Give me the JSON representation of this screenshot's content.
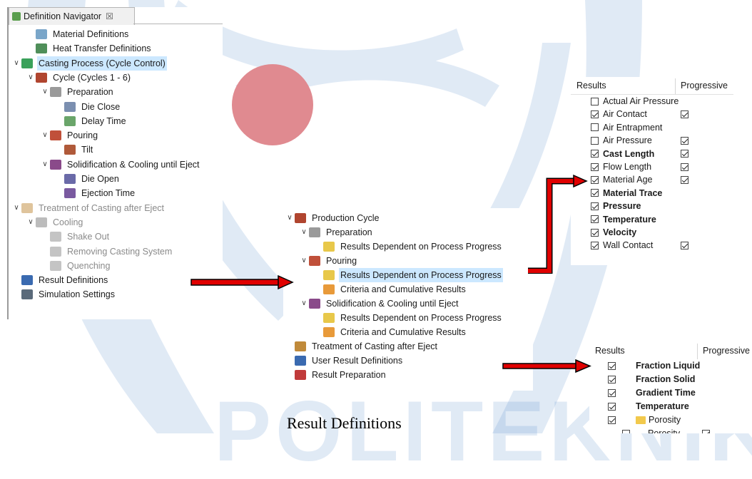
{
  "navigator": {
    "tab_title": "Definition Navigator",
    "tab_close": "☒",
    "items": [
      {
        "label": "Material Definitions",
        "level": 1,
        "icon": "material-icon",
        "twisty": "",
        "state": "normal"
      },
      {
        "label": "Heat Transfer Definitions",
        "level": 1,
        "icon": "heat-transfer-icon",
        "twisty": "",
        "state": "normal"
      },
      {
        "label": "Casting Process (Cycle Control)",
        "level": 0,
        "icon": "cycle-control-icon",
        "twisty": "v",
        "state": "selected"
      },
      {
        "label": "Cycle (Cycles 1 - 6)",
        "level": 1,
        "icon": "cycle-icon",
        "twisty": "v",
        "state": "normal"
      },
      {
        "label": "Preparation",
        "level": 2,
        "icon": "preparation-icon",
        "twisty": "v",
        "state": "normal"
      },
      {
        "label": "Die Close",
        "level": 3,
        "icon": "die-close-icon",
        "twisty": "",
        "state": "normal"
      },
      {
        "label": "Delay Time",
        "level": 3,
        "icon": "delay-time-icon",
        "twisty": "",
        "state": "normal"
      },
      {
        "label": "Pouring",
        "level": 2,
        "icon": "pouring-icon",
        "twisty": "v",
        "state": "normal"
      },
      {
        "label": "Tilt",
        "level": 3,
        "icon": "tilt-icon",
        "twisty": "",
        "state": "normal"
      },
      {
        "label": "Solidification & Cooling until Eject",
        "level": 2,
        "icon": "solidification-icon",
        "twisty": "v",
        "state": "normal"
      },
      {
        "label": "Die Open",
        "level": 3,
        "icon": "die-open-icon",
        "twisty": "",
        "state": "normal"
      },
      {
        "label": "Ejection Time",
        "level": 3,
        "icon": "ejection-icon",
        "twisty": "",
        "state": "normal"
      },
      {
        "label": "Treatment of Casting after Eject",
        "level": 0,
        "icon": "treatment-icon",
        "twisty": "v",
        "state": "dim"
      },
      {
        "label": "Cooling",
        "level": 1,
        "icon": "cooling-icon",
        "twisty": "v",
        "state": "dim"
      },
      {
        "label": "Shake Out",
        "level": 2,
        "icon": "shake-out-icon",
        "twisty": "",
        "state": "dim"
      },
      {
        "label": "Removing Casting System",
        "level": 2,
        "icon": "removing-icon",
        "twisty": "",
        "state": "dim"
      },
      {
        "label": "Quenching",
        "level": 2,
        "icon": "quenching-icon",
        "twisty": "",
        "state": "dim"
      },
      {
        "label": "Result Definitions",
        "level": 0,
        "icon": "result-definitions-icon",
        "twisty": "",
        "state": "normal"
      },
      {
        "label": "Simulation Settings",
        "level": 0,
        "icon": "simulation-settings-icon",
        "twisty": "",
        "state": "normal"
      }
    ]
  },
  "production_tree": {
    "items": [
      {
        "label": "Production Cycle",
        "level": 0,
        "icon": "production-cycle-icon",
        "twisty": "v",
        "state": "normal"
      },
      {
        "label": "Preparation",
        "level": 1,
        "icon": "preparation-icon",
        "twisty": "v",
        "state": "normal"
      },
      {
        "label": "Results Dependent on Process Progress",
        "level": 2,
        "icon": "results-progress-icon",
        "twisty": "",
        "state": "normal"
      },
      {
        "label": "Pouring",
        "level": 1,
        "icon": "pouring-icon",
        "twisty": "v",
        "state": "normal"
      },
      {
        "label": "Results Dependent on Process Progress",
        "level": 2,
        "icon": "results-progress-icon",
        "twisty": "",
        "state": "selected"
      },
      {
        "label": "Criteria and Cumulative Results",
        "level": 2,
        "icon": "criteria-icon",
        "twisty": "",
        "state": "normal"
      },
      {
        "label": "Solidification & Cooling until Eject",
        "level": 1,
        "icon": "solidification-icon",
        "twisty": "v",
        "state": "normal"
      },
      {
        "label": "Results Dependent on Process Progress",
        "level": 2,
        "icon": "results-progress-icon",
        "twisty": "",
        "state": "normal"
      },
      {
        "label": "Criteria and Cumulative Results",
        "level": 2,
        "icon": "criteria-icon",
        "twisty": "",
        "state": "normal"
      },
      {
        "label": "Treatment of Casting after Eject",
        "level": 0,
        "icon": "treatment-icon",
        "twisty": "",
        "state": "normal"
      },
      {
        "label": "User Result Definitions",
        "level": 0,
        "icon": "user-results-icon",
        "twisty": "",
        "state": "normal"
      },
      {
        "label": "Result Preparation",
        "level": 0,
        "icon": "result-preparation-icon",
        "twisty": "",
        "state": "normal"
      }
    ]
  },
  "results_table_1": {
    "header_results": "Results",
    "header_progressive": "Progressive",
    "rows": [
      {
        "label": "Actual Air Pressure",
        "checked": false,
        "progressive": null,
        "bold": false
      },
      {
        "label": "Air Contact",
        "checked": true,
        "progressive": true,
        "bold": false
      },
      {
        "label": "Air Entrapment",
        "checked": false,
        "progressive": null,
        "bold": false
      },
      {
        "label": "Air Pressure",
        "checked": false,
        "progressive": true,
        "bold": false
      },
      {
        "label": "Cast Length",
        "checked": true,
        "progressive": true,
        "bold": true
      },
      {
        "label": "Flow Length",
        "checked": true,
        "progressive": true,
        "bold": false
      },
      {
        "label": "Material Age",
        "checked": true,
        "progressive": true,
        "bold": false
      },
      {
        "label": "Material Trace",
        "checked": true,
        "progressive": null,
        "bold": true
      },
      {
        "label": "Pressure",
        "checked": true,
        "progressive": null,
        "bold": true
      },
      {
        "label": "Temperature",
        "checked": true,
        "progressive": null,
        "bold": true
      },
      {
        "label": "Velocity",
        "checked": true,
        "progressive": null,
        "bold": true
      },
      {
        "label": "Wall Contact",
        "checked": true,
        "progressive": true,
        "bold": false
      }
    ]
  },
  "results_table_2": {
    "header_results": "Results",
    "header_progressive": "Progressive",
    "rows": [
      {
        "label": "Fraction Liquid",
        "checked": true,
        "progressive": null,
        "bold": true,
        "folder": false
      },
      {
        "label": "Fraction Solid",
        "checked": true,
        "progressive": null,
        "bold": true,
        "folder": false
      },
      {
        "label": "Gradient Time",
        "checked": true,
        "progressive": null,
        "bold": true,
        "folder": false
      },
      {
        "label": "Temperature",
        "checked": true,
        "progressive": null,
        "bold": true,
        "folder": false
      },
      {
        "label": "Porosity",
        "checked": true,
        "progressive": null,
        "bold": false,
        "folder": true
      },
      {
        "label": "Porosity",
        "checked": false,
        "progressive": true,
        "bold": false,
        "folder": false
      }
    ]
  },
  "caption": "Result Definitions",
  "watermark_text": "POLITEKNIK",
  "colors": {
    "selection": "#cce8ff",
    "arrow_red": "#e00000",
    "watermark_blue": "#2f6fbf",
    "watermark_red": "#e0303a"
  }
}
